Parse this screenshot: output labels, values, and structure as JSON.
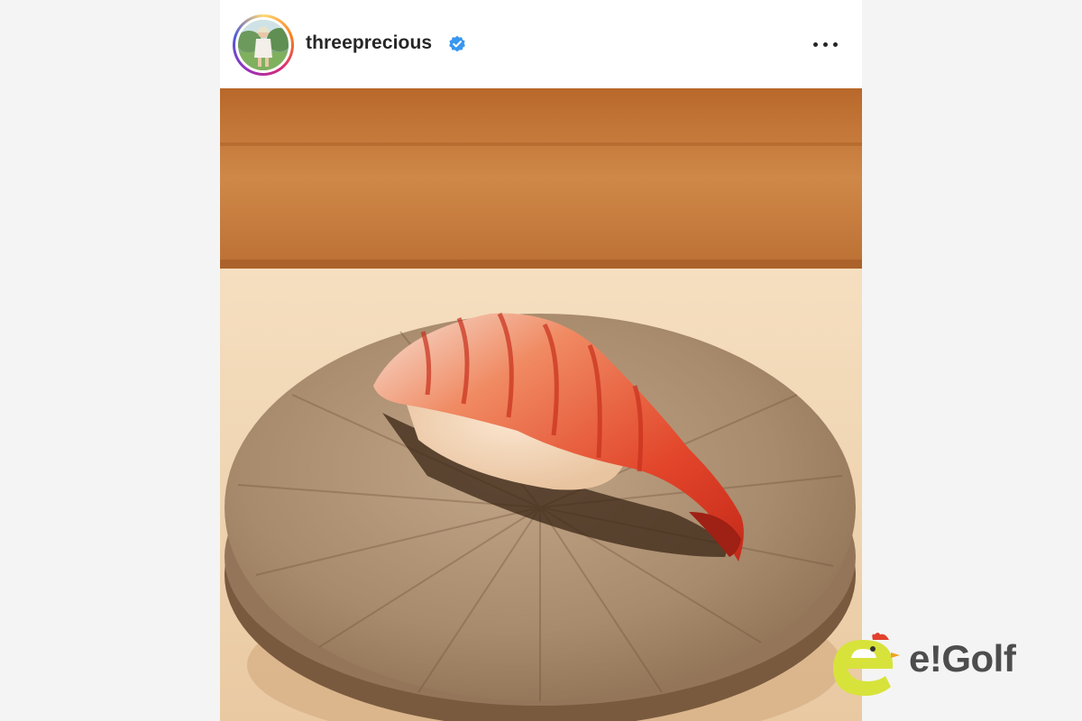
{
  "post": {
    "username": "threeprecious",
    "verified": true,
    "avatar_icon": "profile-photo",
    "more_icon": "more-options-icon"
  },
  "photo": {
    "subject": "shrimp-nigiri-photo"
  },
  "watermark": {
    "logo_text": "e!Golf",
    "brand_color": "#d7e33a"
  },
  "colors": {
    "verified_blue": "#3897f0",
    "wood_wall": "#c0742f",
    "counter": "#f0d6b2",
    "plate": "#a4876a",
    "shrimp": "#e7542f"
  }
}
